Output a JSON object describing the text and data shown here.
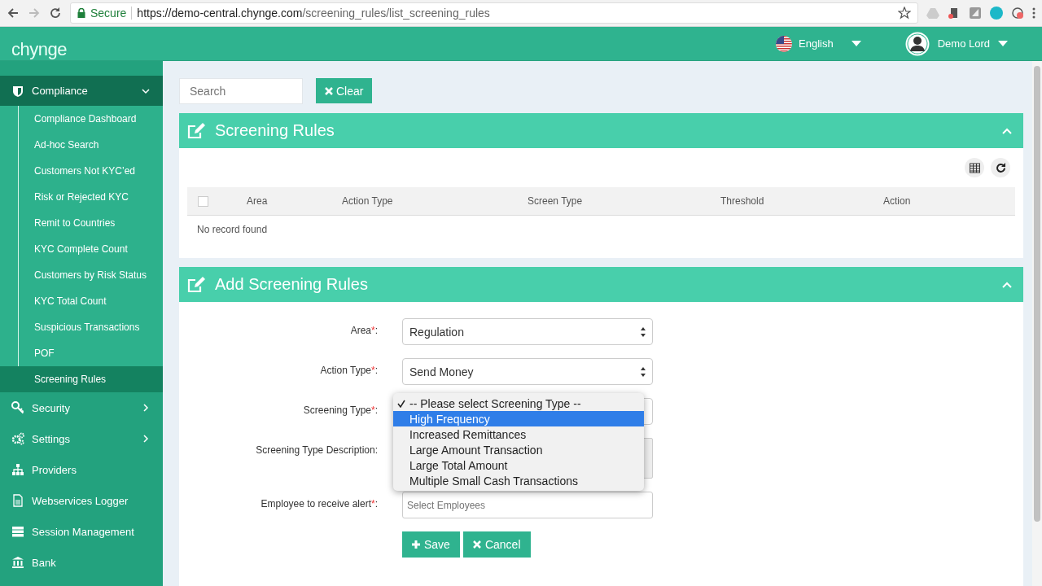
{
  "browser": {
    "secure_label": "Secure",
    "url_host": "https://demo-central.chynge.com",
    "url_path": "/screening_rules/list_screening_rules"
  },
  "header": {
    "logo": "chynge",
    "language": "English",
    "user": "Demo Lord"
  },
  "sidebar": {
    "items": [
      {
        "label": "Compliance",
        "expanded": true,
        "children": [
          {
            "label": "Compliance Dashboard",
            "selected": false
          },
          {
            "label": "Ad-hoc Search",
            "selected": false
          },
          {
            "label": "Customers Not KYC’ed",
            "selected": false
          },
          {
            "label": "Risk or Rejected KYC",
            "selected": false
          },
          {
            "label": "Remit to Countries",
            "selected": false
          },
          {
            "label": "KYC Complete Count",
            "selected": false
          },
          {
            "label": "Customers by Risk Status",
            "selected": false
          },
          {
            "label": "KYC Total Count",
            "selected": false
          },
          {
            "label": "Suspicious Transactions",
            "selected": false
          },
          {
            "label": "POF",
            "selected": false
          },
          {
            "label": "Screening Rules",
            "selected": true
          }
        ]
      },
      {
        "label": "Security",
        "expanded": false
      },
      {
        "label": "Settings",
        "expanded": false
      },
      {
        "label": "Providers"
      },
      {
        "label": "Webservices Logger"
      },
      {
        "label": "Session Management"
      },
      {
        "label": "Bank"
      }
    ]
  },
  "search": {
    "placeholder": "Search"
  },
  "clear_button": "Clear",
  "list_panel": {
    "title": "Screening Rules",
    "table": {
      "select_all_checked": false,
      "columns": [
        "Area",
        "Action Type",
        "Screen Type",
        "Threshold",
        "Action"
      ],
      "empty_text": "No record found"
    }
  },
  "form_panel": {
    "title": "Add Screening Rules",
    "fields": [
      {
        "kind": "select",
        "label": "Area",
        "required_mark": "*",
        "suffix": ":",
        "value": "Regulation"
      },
      {
        "kind": "select",
        "label": "Action Type",
        "required_mark": "*",
        "suffix": ":",
        "value": "Send Money"
      },
      {
        "kind": "dropdown",
        "label": "Screening Type",
        "required_mark": "*",
        "suffix": ":",
        "options": [
          {
            "label": "-- Please select Screening Type --",
            "checked": true,
            "highlighted": false
          },
          {
            "label": "High Frequency",
            "checked": false,
            "highlighted": true
          },
          {
            "label": "Increased Remittances",
            "checked": false,
            "highlighted": false
          },
          {
            "label": "Large Amount Transaction",
            "checked": false,
            "highlighted": false
          },
          {
            "label": "Large Total Amount",
            "checked": false,
            "highlighted": false
          },
          {
            "label": "Multiple Small Cash Transactions",
            "checked": false,
            "highlighted": false
          }
        ]
      },
      {
        "kind": "textarea",
        "label": "Screening Type Description",
        "suffix": ":"
      },
      {
        "kind": "multiselect",
        "label": "Employee to receive alert",
        "required_mark": "*",
        "suffix": ":",
        "placeholder": "Select Employees"
      }
    ],
    "buttons": [
      {
        "kind": "save",
        "label": "Save"
      },
      {
        "kind": "cancel",
        "label": "Cancel"
      }
    ]
  }
}
